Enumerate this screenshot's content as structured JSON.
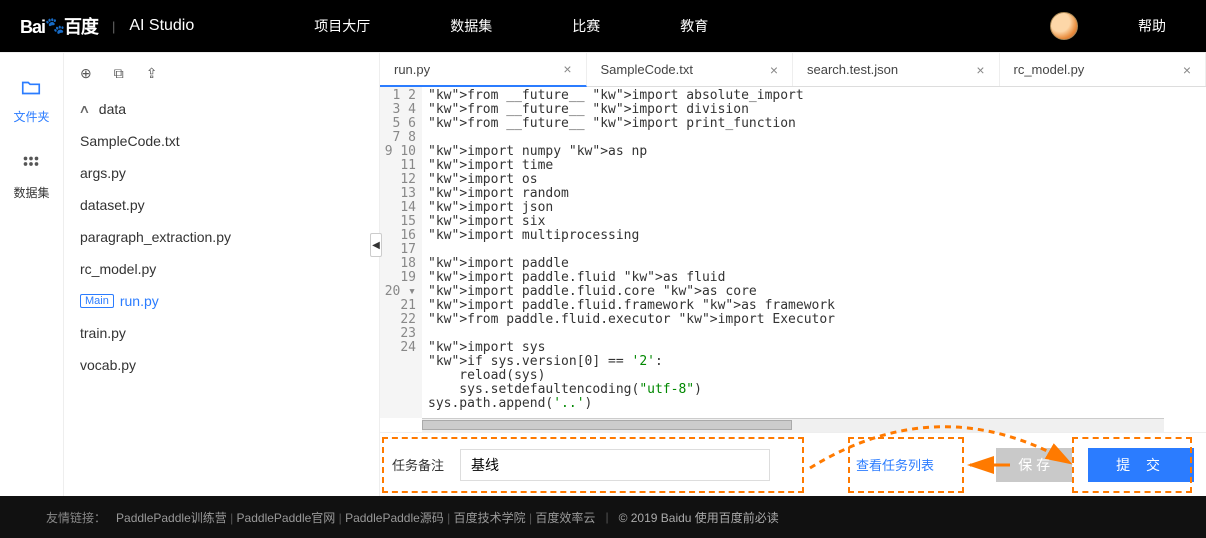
{
  "header": {
    "brand_text": "百度",
    "studio_text": "AI Studio",
    "nav": [
      "项目大厅",
      "数据集",
      "比赛",
      "教育"
    ],
    "help": "帮助"
  },
  "leftcol": {
    "files_label": "文件夹",
    "dataset_label": "数据集"
  },
  "filetree": {
    "folder": "data",
    "items": [
      {
        "name": "SampleCode.txt",
        "main": false,
        "active": false
      },
      {
        "name": "args.py",
        "main": false,
        "active": false
      },
      {
        "name": "dataset.py",
        "main": false,
        "active": false
      },
      {
        "name": "paragraph_extraction.py",
        "main": false,
        "active": false
      },
      {
        "name": "rc_model.py",
        "main": false,
        "active": false
      },
      {
        "name": "run.py",
        "main": true,
        "active": true
      },
      {
        "name": "train.py",
        "main": false,
        "active": false
      },
      {
        "name": "vocab.py",
        "main": false,
        "active": false
      }
    ],
    "main_badge": "Main"
  },
  "tabs": [
    {
      "label": "run.py",
      "active": true
    },
    {
      "label": "SampleCode.txt",
      "active": false
    },
    {
      "label": "search.test.json",
      "active": false
    },
    {
      "label": "rc_model.py",
      "active": false
    }
  ],
  "code_lines": [
    "from __future__ import absolute_import",
    "from __future__ import division",
    "from __future__ import print_function",
    "",
    "import numpy as np",
    "import time",
    "import os",
    "import random",
    "import json",
    "import six",
    "import multiprocessing",
    "",
    "import paddle",
    "import paddle.fluid as fluid",
    "import paddle.fluid.core as core",
    "import paddle.fluid.framework as framework",
    "from paddle.fluid.executor import Executor",
    "",
    "import sys",
    "if sys.version[0] == '2':",
    "    reload(sys)",
    "    sys.setdefaultencoding(\"utf-8\")",
    "sys.path.append('..')",
    ""
  ],
  "task": {
    "label": "任务备注",
    "value": "基线",
    "view_list": "查看任务列表",
    "save": "保 存",
    "submit": "提 交"
  },
  "footer": {
    "label": "友情链接：",
    "links": [
      "PaddlePaddle训练营",
      "PaddlePaddle官网",
      "PaddlePaddle源码",
      "百度技术学院",
      "百度效率云"
    ],
    "copyright": "© 2019 Baidu 使用百度前必读"
  }
}
